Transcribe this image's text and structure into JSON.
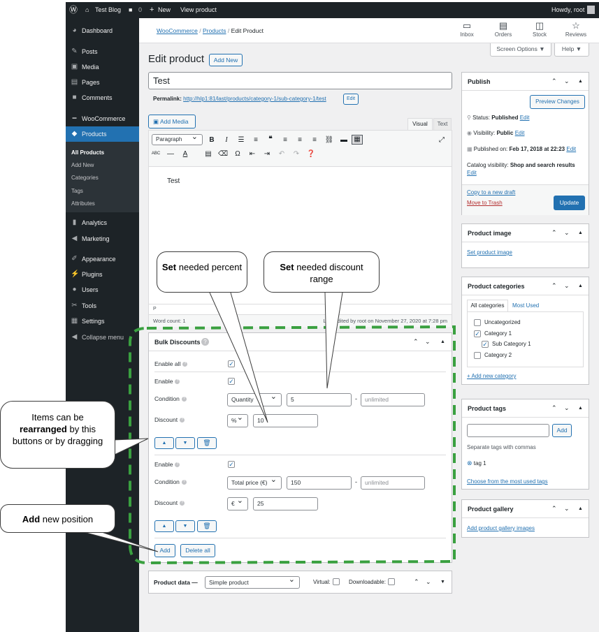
{
  "adminbar": {
    "site": "Test Blog",
    "comments": "0",
    "new": "New",
    "view": "View product",
    "howdy": "Howdy, root"
  },
  "sidebar": {
    "items": [
      {
        "label": "Dashboard",
        "icon": "dashboard-icon"
      },
      {
        "label": "Posts",
        "icon": "pin-icon"
      },
      {
        "label": "Media",
        "icon": "media-icon"
      },
      {
        "label": "Pages",
        "icon": "page-icon"
      },
      {
        "label": "Comments",
        "icon": "comment-icon"
      },
      {
        "label": "WooCommerce",
        "icon": "woo-icon"
      },
      {
        "label": "Products",
        "icon": "products-icon"
      },
      {
        "label": "Analytics",
        "icon": "chart-icon"
      },
      {
        "label": "Marketing",
        "icon": "megaphone-icon"
      },
      {
        "label": "Appearance",
        "icon": "brush-icon"
      },
      {
        "label": "Plugins",
        "icon": "plug-icon"
      },
      {
        "label": "Users",
        "icon": "users-icon"
      },
      {
        "label": "Tools",
        "icon": "wrench-icon"
      },
      {
        "label": "Settings",
        "icon": "settings-icon"
      },
      {
        "label": "Collapse menu",
        "icon": "collapse-icon"
      }
    ],
    "submenu": [
      "All Products",
      "Add New",
      "Categories",
      "Tags",
      "Attributes"
    ]
  },
  "header": {
    "breadcrumb": [
      "WooCommerce",
      "Products",
      "Edit Product"
    ],
    "icons": [
      "Inbox",
      "Orders",
      "Stock",
      "Reviews"
    ],
    "screen_options": "Screen Options ▼",
    "help": "Help ▼"
  },
  "editor": {
    "page_title": "Edit product",
    "add_new": "Add New",
    "title_value": "Test",
    "permalink_label": "Permalink:",
    "permalink_url": "http://hlp1:81/last/products/category-1/sub-category-1/test",
    "edit": "Edit",
    "add_media": "Add Media",
    "tab_visual": "Visual",
    "tab_text": "Text",
    "format": "Paragraph",
    "content": "Test",
    "path": "P",
    "word_count": "Word count: 1",
    "last_edited": "Last edited by root on November 27, 2020 at 7:28 pm"
  },
  "bulk": {
    "title": "Bulk Discounts",
    "enable_all": "Enable all",
    "enable": "Enable",
    "condition": "Condition",
    "discount": "Discount",
    "rules": [
      {
        "condition_type": "Quantity",
        "from": "5",
        "to_placeholder": "unlimited",
        "discount_type": "%",
        "discount": "10"
      },
      {
        "condition_type": "Total price (€)",
        "from": "150",
        "to_placeholder": "unlimited",
        "discount_type": "€",
        "discount": "25"
      }
    ],
    "dash": "-",
    "add": "Add",
    "delete_all": "Delete all"
  },
  "product_data": {
    "label": "Product data —",
    "type": "Simple product",
    "virtual": "Virtual:",
    "downloadable": "Downloadable:"
  },
  "publish": {
    "title": "Publish",
    "preview": "Preview Changes",
    "status_label": "Status:",
    "status": "Published",
    "status_edit": "Edit",
    "visibility_label": "Visibility:",
    "visibility": "Public",
    "visibility_edit": "Edit",
    "published_label": "Published on:",
    "published": "Feb 17, 2018 at 22:23",
    "published_edit": "Edit",
    "catalog_label": "Catalog visibility:",
    "catalog": "Shop and search results",
    "catalog_edit": "Edit",
    "copy": "Copy to a new draft",
    "trash": "Move to Trash",
    "update": "Update"
  },
  "product_image": {
    "title": "Product image",
    "link": "Set product image"
  },
  "categories": {
    "title": "Product categories",
    "tab_all": "All categories",
    "tab_used": "Most Used",
    "items": [
      {
        "label": "Uncategorized",
        "checked": false,
        "indent": false
      },
      {
        "label": "Category 1",
        "checked": true,
        "indent": false
      },
      {
        "label": "Sub Category 1",
        "checked": true,
        "indent": true
      },
      {
        "label": "Category 2",
        "checked": false,
        "indent": false
      }
    ],
    "add_new": "+ Add new category"
  },
  "tags": {
    "title": "Product tags",
    "add": "Add",
    "hint": "Separate tags with commas",
    "tag": "tag 1",
    "choose": "Choose from the most used tags"
  },
  "gallery": {
    "title": "Product gallery",
    "link": "Add product gallery images"
  },
  "callouts": {
    "percent_bold": "Set",
    "percent_rest": " needed percent",
    "range_bold": "Set",
    "range_rest": " needed discount range",
    "rearrange_pre": "Items can be ",
    "rearrange_bold": "rearranged",
    "rearrange_post": " by this buttons or by dragging",
    "add_bold": "Add",
    "add_rest": " new position"
  },
  "colors": {
    "accent": "#2271b1",
    "sidebar": "#1d2327",
    "highlight": "#3aa040"
  }
}
